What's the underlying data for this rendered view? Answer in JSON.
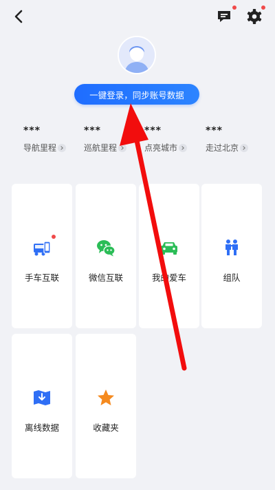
{
  "header": {
    "back_icon": "back-arrow-icon",
    "message_icon": "message-icon",
    "settings_icon": "gear-icon",
    "badge_color": "#f04a4a"
  },
  "profile": {
    "login_button_label": "一键登录，同步账号数据",
    "accent": "#1f6dff"
  },
  "stats": [
    {
      "value": "***",
      "label": "导航里程"
    },
    {
      "value": "***",
      "label": "巡航里程"
    },
    {
      "value": "***",
      "label": "点亮城市"
    },
    {
      "value": "***",
      "label": "走过北京"
    }
  ],
  "tiles": [
    {
      "label": "手车互联",
      "icon": "phone-car-link-icon",
      "color": "#2f6ff5",
      "badge": true
    },
    {
      "label": "微信互联",
      "icon": "wechat-icon",
      "color": "#2bbd57",
      "badge": false
    },
    {
      "label": "我的爱车",
      "icon": "car-icon",
      "color": "#2bbd57",
      "badge": false
    },
    {
      "label": "组队",
      "icon": "team-icon",
      "color": "#2f6ff5",
      "badge": false
    },
    {
      "label": "离线数据",
      "icon": "offline-map-icon",
      "color": "#2f6ff5",
      "badge": false
    },
    {
      "label": "收藏夹",
      "icon": "star-icon",
      "color": "#f58a1f",
      "badge": false
    }
  ],
  "annotation": {
    "arrow_color": "#f20d0d"
  }
}
